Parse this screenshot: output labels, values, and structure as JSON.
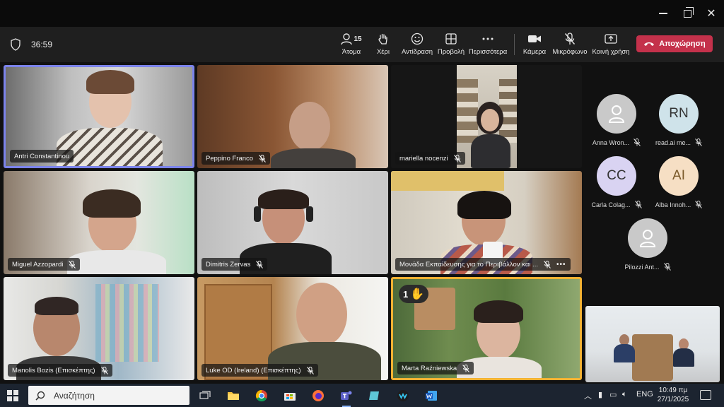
{
  "window": {
    "minimize": "—",
    "close": "✕"
  },
  "toolbar": {
    "timer": "36:59",
    "people_count": "15",
    "buttons": {
      "people": "Άτομα",
      "hand": "Χέρι",
      "react": "Αντίδραση",
      "view": "Προβολή",
      "more": "Περισσότερα",
      "camera": "Κάμερα",
      "mic": "Μικρόφωνο",
      "share": "Κοινή χρήση",
      "leave": "Αποχώρηση"
    }
  },
  "participants": [
    {
      "name": "Antri Constantinou",
      "muted": false
    },
    {
      "name": "Peppino Franco",
      "muted": true
    },
    {
      "name": "mariella nocenzi",
      "muted": true
    },
    {
      "name": "Miguel Azzopardi",
      "muted": true
    },
    {
      "name": "Dimitris Zervas",
      "muted": true
    },
    {
      "name": "Μονάδα Εκπαίδευσης για το Περιβάλλον και ...",
      "muted": true
    },
    {
      "name": "Manolis Bozis (Επισκέπτης)",
      "muted": true
    },
    {
      "name": "Luke OD (Ireland) (Επισκέπτης)",
      "muted": true
    },
    {
      "name": "Marta Raźniewska",
      "muted": true,
      "hand_count": "1"
    }
  ],
  "roster": [
    {
      "name": "Anna Wron...",
      "initials": "",
      "color": "#c9c9c9"
    },
    {
      "name": "read.ai me...",
      "initials": "RN",
      "color": "#cfe3ea"
    },
    {
      "name": "Carla Colag...",
      "initials": "CC",
      "color": "#d9d3f2"
    },
    {
      "name": "Alba Innoh...",
      "initials": "AI",
      "color": "#f6dfc4"
    },
    {
      "name": "Pilozzi Ant...",
      "initials": "",
      "color": "#c9c9c9"
    }
  ],
  "taskbar": {
    "search_placeholder": "Αναζήτηση",
    "lang": "ENG",
    "time": "10:49 πμ",
    "date": "27/1/2025"
  },
  "colors": {
    "leave": "#c4314b",
    "active_speaker": "#7b83eb",
    "hand_raised": "#f2b233"
  }
}
